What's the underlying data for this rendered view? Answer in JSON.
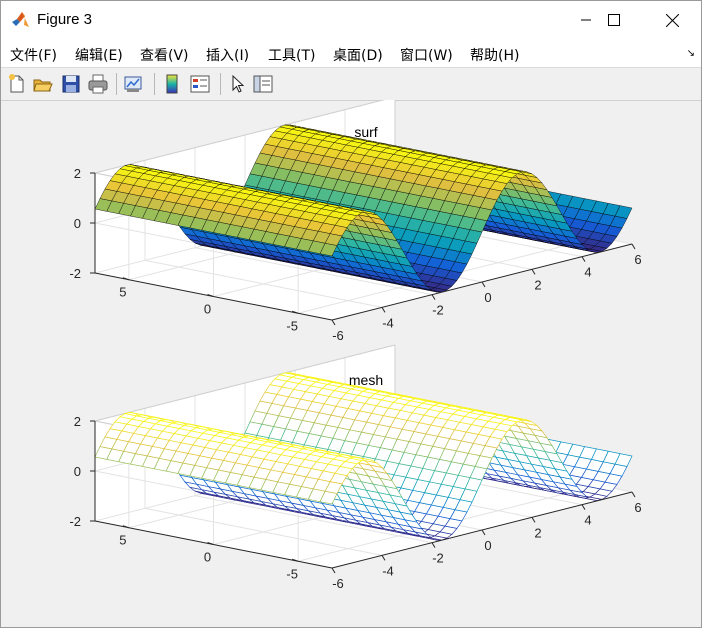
{
  "window": {
    "title": "Figure 3",
    "controls": {
      "minimize": "minimize",
      "maximize": "maximize",
      "close": "close"
    }
  },
  "menu": {
    "items": [
      {
        "label": "文件(F)"
      },
      {
        "label": "编辑(E)"
      },
      {
        "label": "查看(V)"
      },
      {
        "label": "插入(I)"
      },
      {
        "label": "工具(T)"
      },
      {
        "label": "桌面(D)"
      },
      {
        "label": "窗口(W)"
      },
      {
        "label": "帮助(H)"
      }
    ],
    "dock_arrow": "↘"
  },
  "toolbar": {
    "buttons": [
      "new-figure-icon",
      "open-file-icon",
      "save-icon",
      "print-icon",
      "link-plot-icon",
      "colorbar-icon",
      "legend-icon",
      "pointer-icon",
      "property-inspector-icon"
    ]
  },
  "colors": {
    "accent_surf_edge": "#000000",
    "background": "#f0f0f0"
  },
  "chart_data": [
    {
      "type": "surface",
      "title": "surf",
      "function": "z = 2*sin(x)",
      "x_ticks": [
        "-6",
        "-4",
        "-2",
        "0",
        "2",
        "4",
        "6"
      ],
      "y_ticks": [
        "5",
        "0",
        "-5"
      ],
      "z_ticks": [
        "2",
        "0",
        "-2"
      ],
      "xlim": [
        -6,
        6
      ],
      "ylim": [
        -7,
        7
      ],
      "zlim": [
        -2,
        2
      ],
      "colormap": "parula",
      "grid": true,
      "edge_color": "black"
    },
    {
      "type": "mesh",
      "title": "mesh",
      "function": "z = 2*sin(x)",
      "x_ticks": [
        "-6",
        "-4",
        "-2",
        "0",
        "2",
        "4",
        "6"
      ],
      "y_ticks": [
        "5",
        "0",
        "-5"
      ],
      "z_ticks": [
        "2",
        "0",
        "-2"
      ],
      "xlim": [
        -6,
        6
      ],
      "ylim": [
        -7,
        7
      ],
      "zlim": [
        -2,
        2
      ],
      "colormap": "parula",
      "grid": true,
      "edge_color": "colormap"
    }
  ]
}
